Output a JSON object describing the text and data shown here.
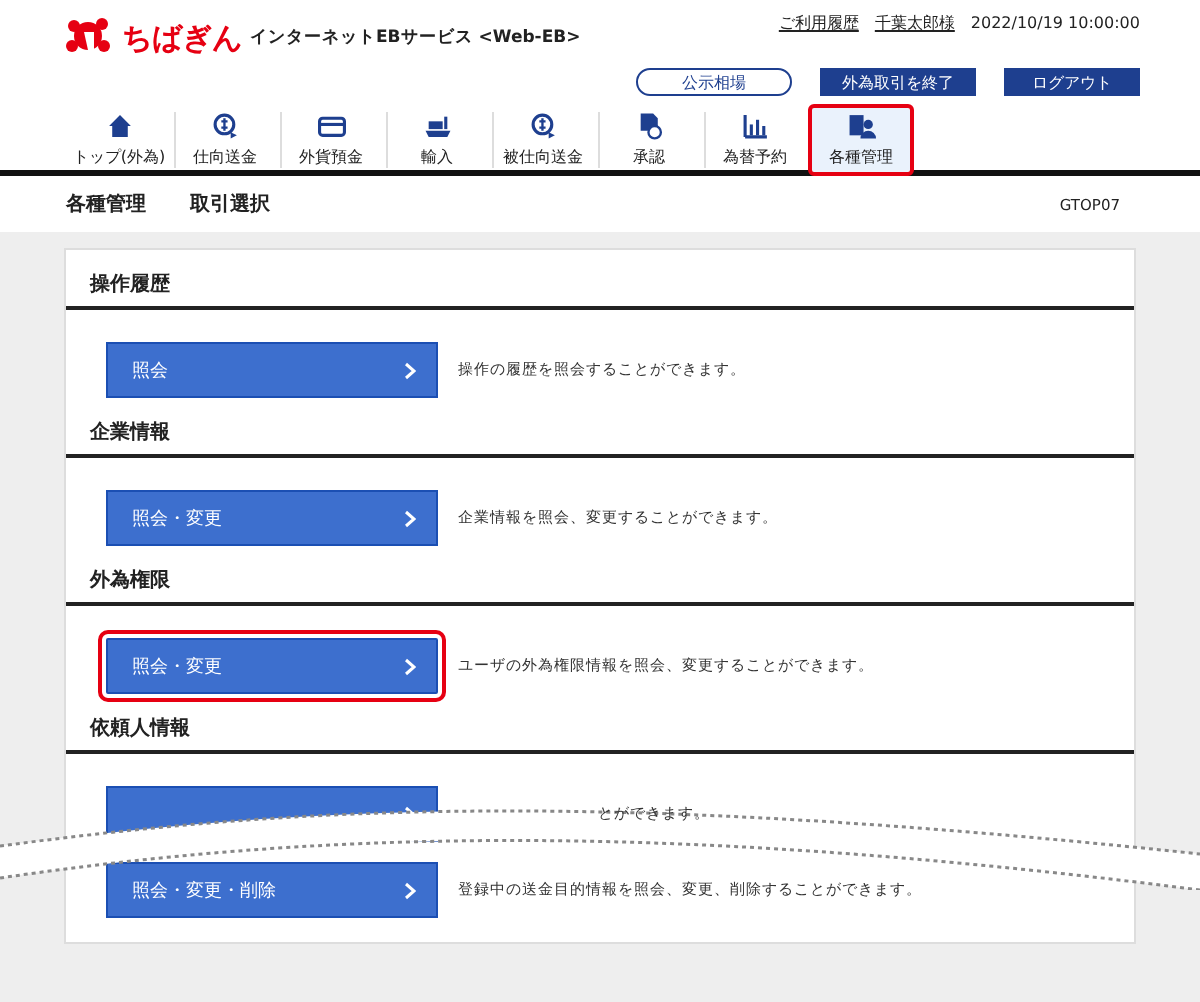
{
  "header": {
    "brand": "ちばぎん",
    "service": "インターネットEBサービス <Web-EB>",
    "links": [
      "ご利用履歴",
      "千葉太郎様"
    ],
    "datetime": "2022/10/19 10:00:00",
    "buttons": [
      {
        "label": "公示相場",
        "kind": "outline"
      },
      {
        "label": "外為取引を終了",
        "kind": "solid"
      },
      {
        "label": "ログアウト",
        "kind": "solid"
      }
    ]
  },
  "nav": [
    {
      "label": "トップ(外為)",
      "kind": "home",
      "selected": false
    },
    {
      "label": "仕向送金",
      "kind": "coin",
      "selected": false
    },
    {
      "label": "外貨預金",
      "kind": "card",
      "selected": false
    },
    {
      "label": "輸入",
      "kind": "ship",
      "selected": false
    },
    {
      "label": "被仕向送金",
      "kind": "coin",
      "selected": false
    },
    {
      "label": "承認",
      "kind": "doc",
      "selected": false
    },
    {
      "label": "為替予約",
      "kind": "chart",
      "selected": false
    },
    {
      "label": "各種管理",
      "kind": "user",
      "selected": true
    }
  ],
  "breadcrumb": [
    "各種管理",
    "取引選択"
  ],
  "screen_id": "GTOP07",
  "sections": [
    {
      "title": "操作履歴",
      "rows": [
        {
          "button": "照会",
          "description": "操作の履歴を照会することができます。",
          "highlighted": false
        }
      ]
    },
    {
      "title": "企業情報",
      "rows": [
        {
          "button": "照会・変更",
          "description": "企業情報を照会、変更することができます。",
          "highlighted": false
        }
      ]
    },
    {
      "title": "外為権限",
      "rows": [
        {
          "button": "照会・変更",
          "description": "ユーザの外為権限情報を照会、変更することができます。",
          "highlighted": true
        }
      ]
    },
    {
      "title": "依頼人情報",
      "rows": [
        {
          "kind": "torn",
          "description": "とができます。",
          "highlighted": false
        },
        {
          "button": "照会・変更・削除",
          "description": "登録中の送金目的情報を照会、変更、削除することができます。",
          "highlighted": false
        }
      ]
    }
  ]
}
